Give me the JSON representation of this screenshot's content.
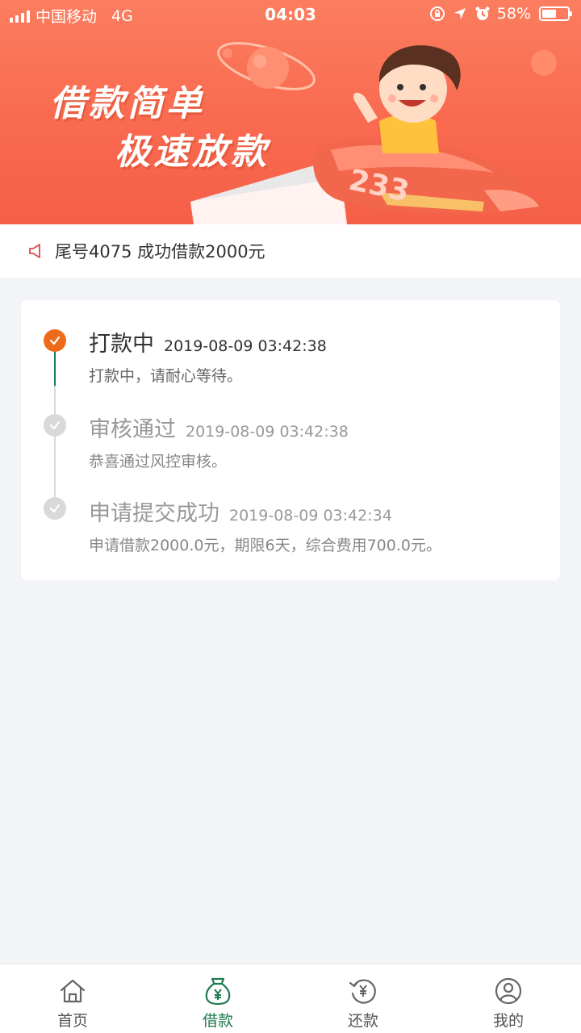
{
  "status_bar": {
    "carrier": "中国移动",
    "network": "4G",
    "time": "04:03",
    "battery": "58%",
    "battery_level": 0.58
  },
  "banner": {
    "line1": "借款简单",
    "line2": "极速放款",
    "plane_number": "233"
  },
  "notice": {
    "text": "尾号4075 成功借款2000元",
    "icon": "megaphone-icon"
  },
  "timeline": [
    {
      "title": "打款中",
      "time": "2019-08-09 03:42:38",
      "desc": "打款中，请耐心等待。",
      "state": "active"
    },
    {
      "title": "审核通过",
      "time": "2019-08-09 03:42:38",
      "desc": "恭喜通过风控审核。",
      "state": "done"
    },
    {
      "title": "申请提交成功",
      "time": "2019-08-09 03:42:34",
      "desc": "申请借款2000.0元，期限6天，综合费用700.0元。",
      "state": "done"
    }
  ],
  "tabbar": {
    "items": [
      {
        "label": "首页",
        "icon": "home-icon"
      },
      {
        "label": "借款",
        "icon": "money-bag-icon",
        "active": true
      },
      {
        "label": "还款",
        "icon": "yuan-refresh-icon"
      },
      {
        "label": "我的",
        "icon": "user-icon"
      }
    ]
  },
  "colors": {
    "banner": "#fb7d5f",
    "active_step": "#ee6b1c",
    "active_tab": "#1d7a4e",
    "timeline_line": "#1d7a4e",
    "inactive_step": "#d9d9d9",
    "page_background": "#f3f4f8"
  }
}
